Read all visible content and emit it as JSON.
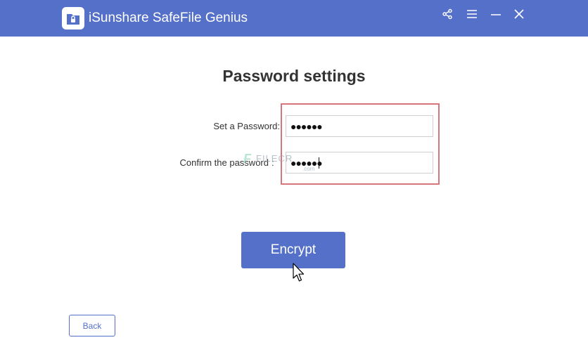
{
  "window": {
    "title": "iSunshare SafeFile Genius",
    "controls": [
      "share-icon",
      "menu-icon",
      "minimize-icon",
      "close-icon"
    ]
  },
  "main": {
    "heading": "Password settings",
    "set_password": {
      "label": "Set a Password:",
      "value": "●●●●●●"
    },
    "confirm_password": {
      "label": "Confirm the password",
      "colon": ":",
      "value": "●●●●●●"
    },
    "encrypt_label": "Encrypt",
    "back_label": "Back"
  },
  "watermark": {
    "mark": "F",
    "text": "FILECR",
    "sub": ".com"
  },
  "colors": {
    "accent": "#5470c9",
    "highlight": "#d9747c"
  }
}
